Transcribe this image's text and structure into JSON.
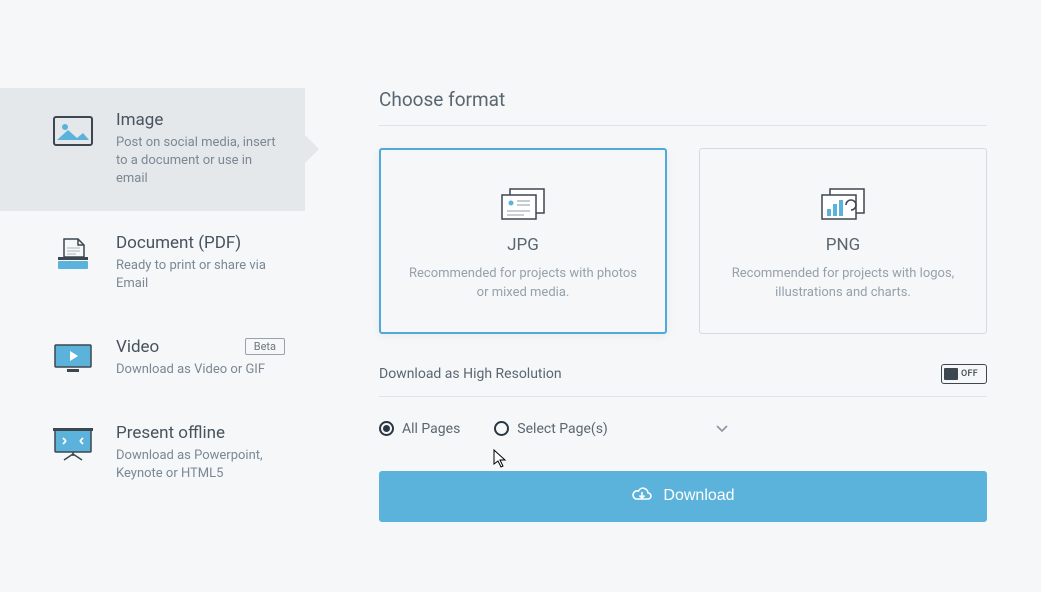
{
  "sidebar": {
    "items": [
      {
        "title": "Image",
        "desc": "Post on social media, insert to a document or use in email",
        "active": true
      },
      {
        "title": "Document (PDF)",
        "desc": "Ready to print or share via Email",
        "active": false
      },
      {
        "title": "Video",
        "desc": "Download as Video or GIF",
        "beta": "Beta",
        "active": false
      },
      {
        "title": "Present offline",
        "desc": "Download as Powerpoint, Keynote or HTML5",
        "active": false
      }
    ]
  },
  "main": {
    "heading": "Choose format",
    "formats": [
      {
        "name": "JPG",
        "desc": "Recommended for projects with photos or mixed media.",
        "selected": true
      },
      {
        "name": "PNG",
        "desc": "Recommended for projects with logos, illustrations and charts.",
        "selected": false
      }
    ],
    "highres_label": "Download as High Resolution",
    "toggle_state": "OFF",
    "pages": {
      "all_label": "All Pages",
      "select_label": "Select Page(s)",
      "selected": "all"
    },
    "download_button": "Download"
  }
}
